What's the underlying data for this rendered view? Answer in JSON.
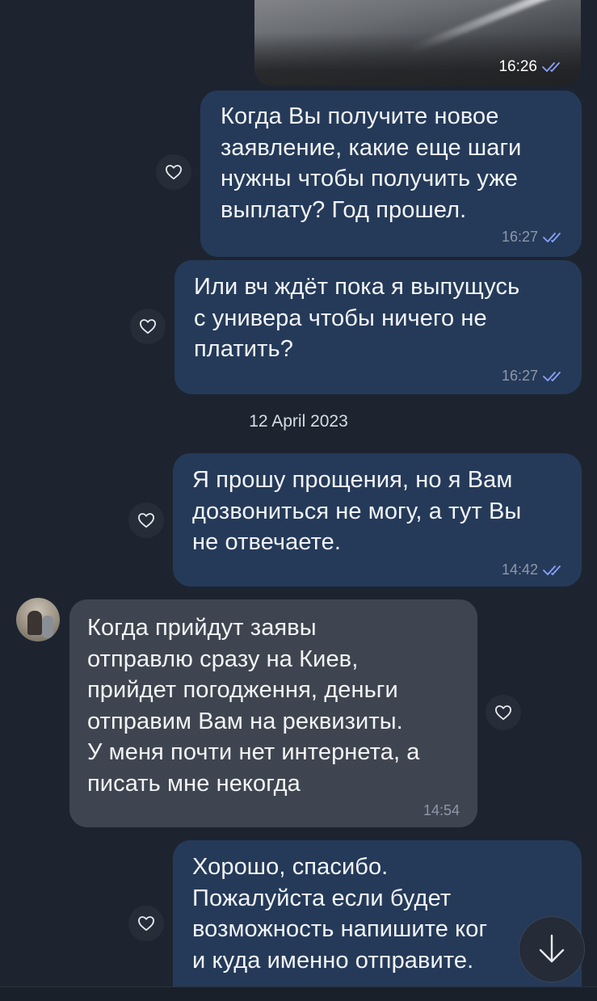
{
  "top_clipped_text": "",
  "messages": [
    {
      "id": "photo",
      "time": "16:26"
    },
    {
      "id": "m1",
      "text": "Когда Вы получите новое\nзаявление, какие еще шаги\nнужны чтобы получить уже\nвыплату? Год прошел.",
      "time": "16:27"
    },
    {
      "id": "m2",
      "text": "Или вч ждёт пока я выпущусь\nс универа чтобы ничего не\nплатить?",
      "time": "16:27"
    },
    {
      "id": "date",
      "text": "12 April 2023"
    },
    {
      "id": "m3",
      "text": "Я прошу прощения, но я Вам\nдозвониться не могу, а тут Вы\nне отвечаете.",
      "time": "14:42"
    },
    {
      "id": "m4",
      "text": "Когда прийдут заявы\nотправлю сразу на Киев,\nприйдет погодження, деньги\nотправим Вам на реквизиты.\nУ меня почти нет интернета, а\nписать мне некогда",
      "time": "14:54"
    },
    {
      "id": "m5",
      "text": "Хорошо, спасибо.\nПожалуйста если будет\nвозможность напишите ког\nи куда именно отправите."
    }
  ],
  "colors": {
    "background": "#1d2430",
    "outgoing_bubble": "#253a59",
    "incoming_bubble": "#3f4550",
    "read_checks": "#8aa2ff"
  },
  "icons": {
    "reaction": "heart-outline-icon",
    "read_status": "double-check-icon",
    "scroll_down": "arrow-down-icon"
  }
}
